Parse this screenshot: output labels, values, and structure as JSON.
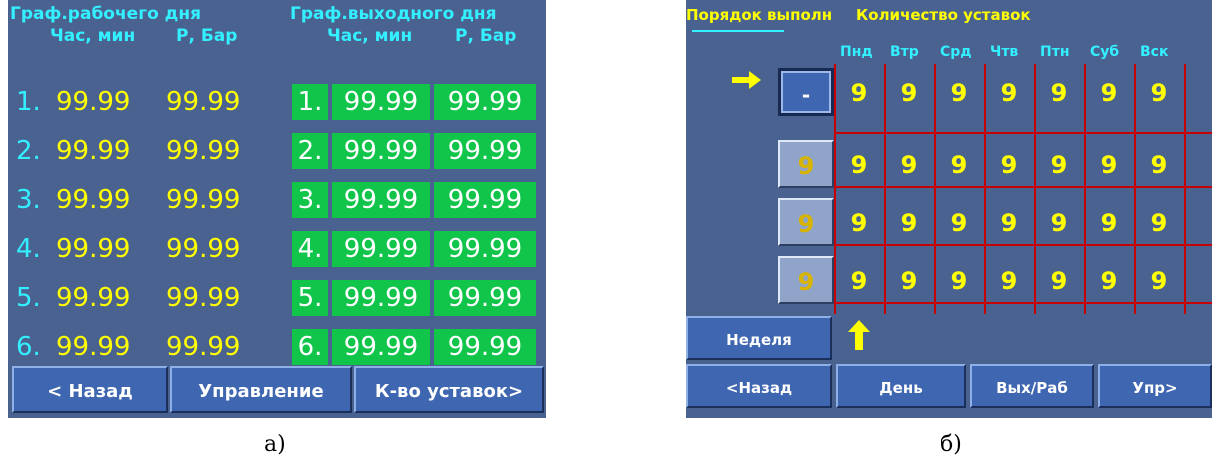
{
  "panel_a": {
    "header_work": "Граф.рабочего дня",
    "header_off": "Граф.выходного дня",
    "col_time": "Час, мин",
    "col_pressure": "Р, Бар",
    "rows": [
      {
        "num": "1.",
        "work_time": "99.99",
        "work_pressure": "99.99",
        "off_time": "99.99",
        "off_pressure": "99.99"
      },
      {
        "num": "2.",
        "work_time": "99.99",
        "work_pressure": "99.99",
        "off_time": "99.99",
        "off_pressure": "99.99"
      },
      {
        "num": "3.",
        "work_time": "99.99",
        "work_pressure": "99.99",
        "off_time": "99.99",
        "off_pressure": "99.99"
      },
      {
        "num": "4.",
        "work_time": "99.99",
        "work_pressure": "99.99",
        "off_time": "99.99",
        "off_pressure": "99.99"
      },
      {
        "num": "5.",
        "work_time": "99.99",
        "work_pressure": "99.99",
        "off_time": "99.99",
        "off_pressure": "99.99"
      },
      {
        "num": "6.",
        "work_time": "99.99",
        "work_pressure": "99.99",
        "off_time": "99.99",
        "off_pressure": "99.99"
      }
    ],
    "buttons": {
      "back": "< Назад",
      "control": "Управление",
      "setpoints": "К-во уставок>"
    },
    "colors": {
      "background": "#4a6290",
      "time_text": "#ffff00",
      "index_text": "#33f0ff",
      "off_cell": "#11c44a"
    }
  },
  "panel_b": {
    "header_order": "Порядок выполн",
    "header_count": "Количество уставок",
    "days": [
      "Пнд",
      "Втр",
      "Срд",
      "Чтв",
      "Птн",
      "Суб",
      "Вск"
    ],
    "rows": [
      {
        "order": "-",
        "values": [
          "9",
          "9",
          "9",
          "9",
          "9",
          "9",
          "9"
        ]
      },
      {
        "order": "9",
        "values": [
          "9",
          "9",
          "9",
          "9",
          "9",
          "9",
          "9"
        ]
      },
      {
        "order": "9",
        "values": [
          "9",
          "9",
          "9",
          "9",
          "9",
          "9",
          "9"
        ]
      },
      {
        "order": "9",
        "values": [
          "9",
          "9",
          "9",
          "9",
          "9",
          "9",
          "9"
        ]
      }
    ],
    "buttons": {
      "week": "Неделя",
      "back": "<Назад",
      "day": "День",
      "off_work": "Вых/Раб",
      "control": "Упр>"
    },
    "icons": {
      "row_pointer": "arrow-right-icon",
      "up_pointer": "arrow-up-icon"
    }
  },
  "captions": {
    "a": "а)",
    "b": "б)"
  }
}
